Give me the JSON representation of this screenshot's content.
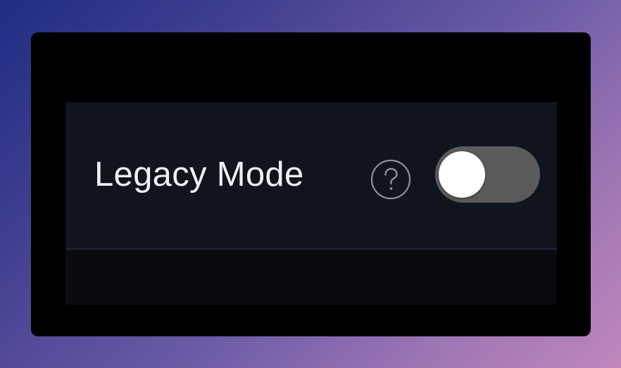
{
  "setting": {
    "label": "Legacy Mode",
    "help_icon": "question-circle-icon",
    "toggle_enabled": false
  },
  "colors": {
    "toggle_track_off": "#5a5a5a",
    "toggle_knob": "#ffffff",
    "row_background": "#10141e",
    "window_background": "#000000",
    "label_text": "#eef0f4"
  }
}
